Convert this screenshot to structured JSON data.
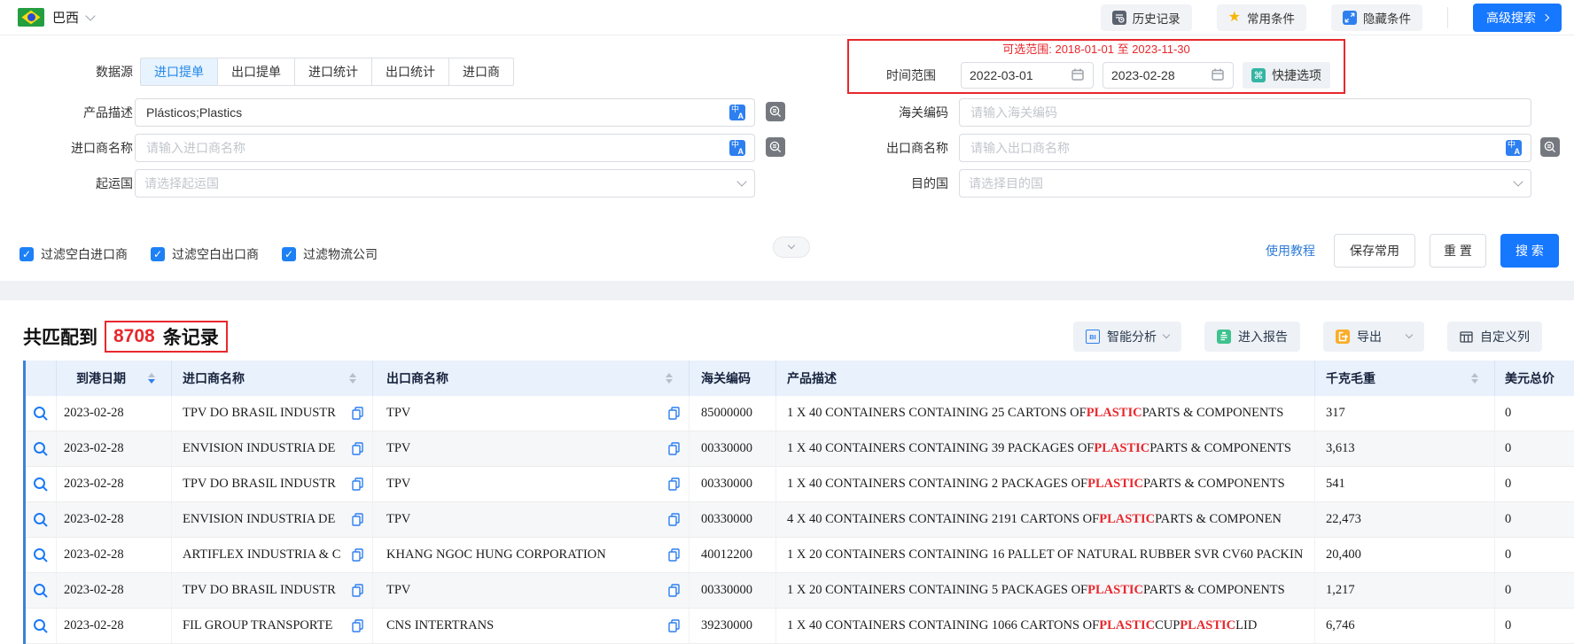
{
  "topbar": {
    "country": "巴西",
    "history_label": "历史记录",
    "favorites_label": "常用条件",
    "hide_label": "隐藏条件",
    "advanced_label": "高级搜索"
  },
  "form": {
    "datasource_label": "数据源",
    "tabs": [
      {
        "label": "进口提单",
        "active": true
      },
      {
        "label": "出口提单",
        "active": false
      },
      {
        "label": "进口统计",
        "active": false
      },
      {
        "label": "出口统计",
        "active": false
      },
      {
        "label": "进口商",
        "active": false
      }
    ],
    "time_range": {
      "hint": "可选范围: 2018-01-01 至 2023-11-30",
      "label": "时间范围",
      "start": "2022-03-01",
      "end": "2023-02-28",
      "quick_label": "快捷选项"
    },
    "product_desc": {
      "label": "产品描述",
      "value": "Plásticos;Plastics"
    },
    "hs_code": {
      "label": "海关编码",
      "placeholder": "请输入海关编码"
    },
    "importer": {
      "label": "进口商名称",
      "placeholder": "请输入进口商名称"
    },
    "exporter": {
      "label": "出口商名称",
      "placeholder": "请输入出口商名称"
    },
    "origin": {
      "label": "起运国",
      "placeholder": "请选择起运国"
    },
    "dest": {
      "label": "目的国",
      "placeholder": "请选择目的国"
    },
    "checkboxes": [
      {
        "label": "过滤空白进口商",
        "checked": true
      },
      {
        "label": "过滤空白出口商",
        "checked": true
      },
      {
        "label": "过滤物流公司",
        "checked": true
      }
    ],
    "actions": {
      "tutorial": "使用教程",
      "save": "保存常用",
      "reset": "重 置",
      "search": "搜 索"
    }
  },
  "results": {
    "summary": {
      "prefix": "共匹配到",
      "count": "8708",
      "suffix": "条记录"
    },
    "toolbar": {
      "analysis": "智能分析",
      "report": "进入报告",
      "export": "导出",
      "columns": "自定义列"
    },
    "table": {
      "columns": [
        {
          "label": "到港日期",
          "sortable": true,
          "sort": "desc"
        },
        {
          "label": "进口商名称",
          "sortable": true,
          "sort": ""
        },
        {
          "label": "出口商名称",
          "sortable": true,
          "sort": ""
        },
        {
          "label": "海关编码",
          "sortable": false,
          "sort": ""
        },
        {
          "label": "产品描述",
          "sortable": false,
          "sort": ""
        },
        {
          "label": "千克毛重",
          "sortable": true,
          "sort": ""
        },
        {
          "label": "美元总价",
          "sortable": false,
          "sort": ""
        }
      ],
      "highlight": "PLASTIC",
      "highlight_color": "#e8282d",
      "rows": [
        {
          "date": "2023-02-28",
          "importer": "TPV DO BRASIL INDUSTR",
          "exporter": "TPV",
          "hs": "85000000",
          "desc": "1 X 40 CONTAINERS CONTAINING 25 CARTONS OF PLASTIC PARTS & COMPONENTS",
          "weight": "317",
          "usd": "0"
        },
        {
          "date": "2023-02-28",
          "importer": "ENVISION INDUSTRIA DE",
          "exporter": "TPV",
          "hs": "00330000",
          "desc": "1 X 40 CONTAINERS CONTAINING 39 PACKAGES OF PLASTIC PARTS & COMPONENTS",
          "weight": "3,613",
          "usd": "0"
        },
        {
          "date": "2023-02-28",
          "importer": "TPV DO BRASIL INDUSTR",
          "exporter": "TPV",
          "hs": "00330000",
          "desc": "1 X 40 CONTAINERS CONTAINING 2 PACKAGES OF PLASTIC PARTS & COMPONENTS",
          "weight": "541",
          "usd": "0"
        },
        {
          "date": "2023-02-28",
          "importer": "ENVISION INDUSTRIA DE",
          "exporter": "TPV",
          "hs": "00330000",
          "desc": "4 X 40 CONTAINERS CONTAINING 2191 CARTONS OF PLASTIC PARTS & COMPONEN",
          "weight": "22,473",
          "usd": "0"
        },
        {
          "date": "2023-02-28",
          "importer": "ARTIFLEX INDUSTRIA & C",
          "exporter": "KHANG NGOC HUNG CORPORATION",
          "hs": "40012200",
          "desc": "1 X 20 CONTAINERS CONTAINING 16 PALLET OF NATURAL RUBBER SVR CV60 PACKIN",
          "weight": "20,400",
          "usd": "0"
        },
        {
          "date": "2023-02-28",
          "importer": "TPV DO BRASIL INDUSTR",
          "exporter": "TPV",
          "hs": "00330000",
          "desc": "1 X 20 CONTAINERS CONTAINING 5 PACKAGES OF PLASTIC PARTS & COMPONENTS",
          "weight": "1,217",
          "usd": "0"
        },
        {
          "date": "2023-02-28",
          "importer": "FIL GROUP TRANSPORTE",
          "exporter": "CNS INTERTRANS",
          "hs": "39230000",
          "desc": "1 X 40 CONTAINERS CONTAINING 1066 CARTONS OF PLASTIC CUP PLASTIC LID",
          "weight": "6,746",
          "usd": "0"
        }
      ]
    }
  },
  "colors": {
    "primary": "#1677ff",
    "red": "#e8282d",
    "table_header_bg": "#e9f1fc"
  }
}
